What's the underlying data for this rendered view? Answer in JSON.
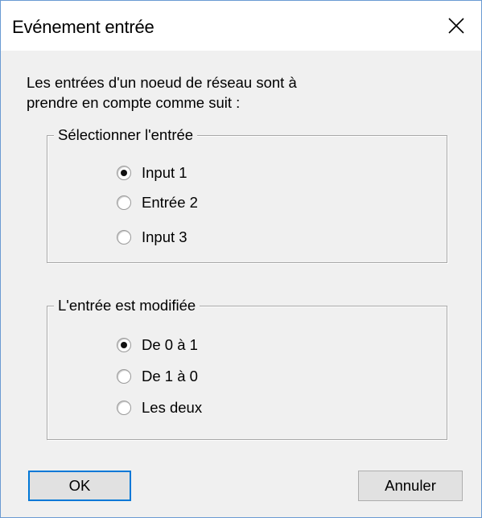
{
  "window": {
    "title": "Evénement entrée"
  },
  "description": {
    "line1": "Les entrées d'un noeud de réseau sont à",
    "line2": "prendre en compte comme suit :"
  },
  "select_input_group": {
    "legend": "Sélectionner l'entrée",
    "options": [
      {
        "label": "Input 1",
        "checked": true
      },
      {
        "label": "Entrée 2",
        "checked": false
      },
      {
        "label": "Input 3",
        "checked": false
      }
    ]
  },
  "change_group": {
    "legend": "L'entrée est modifiée",
    "options": [
      {
        "label": "De 0 à 1",
        "checked": true
      },
      {
        "label": "De 1 à 0",
        "checked": false
      },
      {
        "label": "Les deux",
        "checked": false
      }
    ]
  },
  "buttons": {
    "ok": "OK",
    "cancel": "Annuler"
  },
  "icons": {
    "close": "close-icon"
  },
  "colors": {
    "window_border": "#6a9ad3",
    "default_button_border": "#0078d7"
  }
}
